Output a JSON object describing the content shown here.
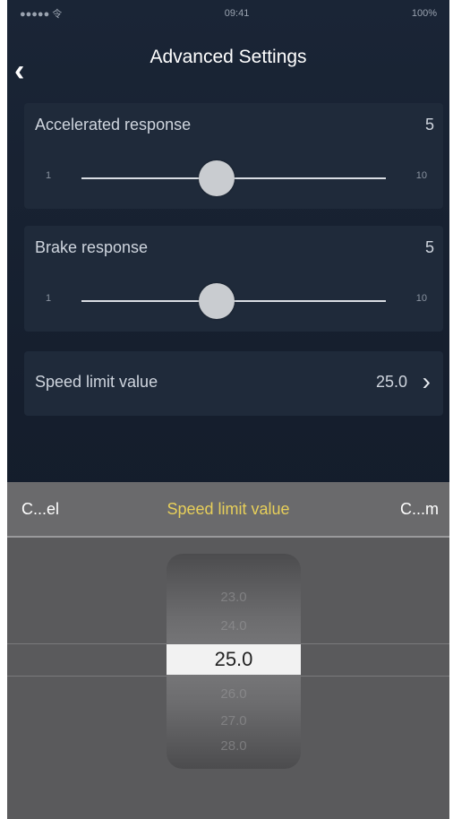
{
  "status_bar": {
    "left": "●●●●● 令",
    "center": "09:41",
    "right": "100%"
  },
  "header": {
    "title": "Advanced Settings"
  },
  "settings": [
    {
      "label": "Accelerated response",
      "value": "5",
      "min": "1",
      "max": "10",
      "level": 5
    },
    {
      "label": "Brake response",
      "value": "5",
      "min": "1",
      "max": "10",
      "level": 5
    }
  ],
  "speed_limit": {
    "label": "Speed limit value",
    "value": "25.0"
  },
  "picker": {
    "cancel_label": "C...el",
    "title": "Speed limit value",
    "confirm_label": "C...m",
    "options_above": [
      "23.0",
      "24.0"
    ],
    "selected": "25.0",
    "options_below": [
      "26.0",
      "27.0",
      "28.0"
    ]
  },
  "colors": {
    "background": "#1a2233",
    "card": "#1f2a3a",
    "picker_title": "#e7cf5a",
    "picker_bg": "#5a5a5c"
  }
}
